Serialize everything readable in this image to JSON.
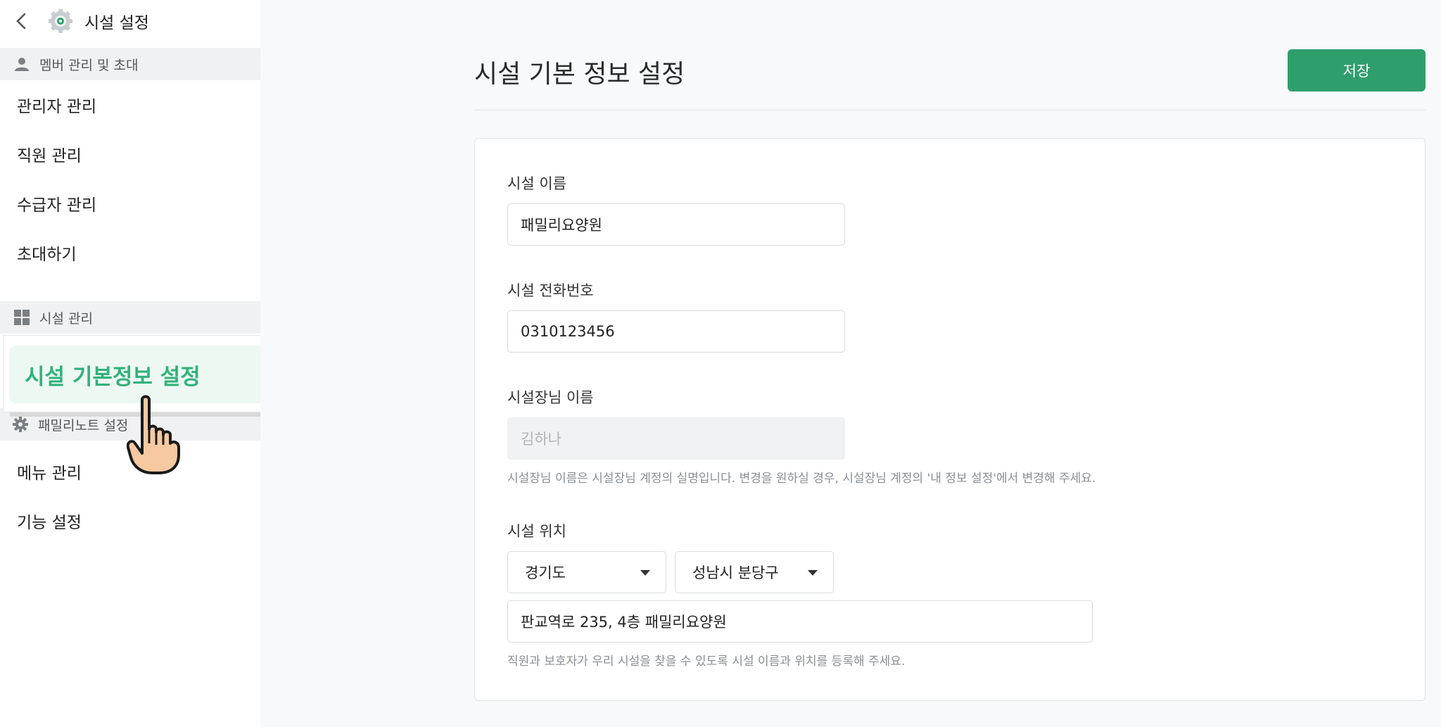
{
  "sidebar": {
    "title": "시설 설정",
    "sections": [
      {
        "label": "멤버 관리 및 초대",
        "icon": "person-icon",
        "items": [
          "관리자 관리",
          "직원 관리",
          "수급자 관리",
          "초대하기"
        ]
      },
      {
        "label": "시설 관리",
        "icon": "grid-icon",
        "items": [
          "시설 기본정보 설정"
        ]
      },
      {
        "label": "패밀리노트 설정",
        "icon": "gear-icon",
        "items": [
          "메뉴 관리",
          "기능 설정"
        ]
      }
    ]
  },
  "main": {
    "title": "시설 기본 정보 설정",
    "save_label": "저장",
    "fields": {
      "name": {
        "label": "시설 이름",
        "value": "패밀리요양원"
      },
      "phone": {
        "label": "시설 전화번호",
        "value": "0310123456"
      },
      "director": {
        "label": "시설장님 이름",
        "placeholder": "김하나",
        "help": "시설장님 이름은 시설장님 계정의 실명입니다. 변경을 원하실 경우, 시설장님 계정의 '내 정보 설정'에서 변경해 주세요."
      },
      "location": {
        "label": "시설 위치",
        "province": "경기도",
        "city": "성남시 분당구",
        "address": "판교역로 235, 4층 패밀리요양원",
        "help": "직원과 보호자가 우리 시설을 찾을 수 있도록 시설 이름과 위치를 등록해 주세요."
      }
    }
  },
  "colors": {
    "accent": "#2f9e6d",
    "highlight_text": "#31b27a",
    "highlight_bg": "#edf8f3"
  }
}
